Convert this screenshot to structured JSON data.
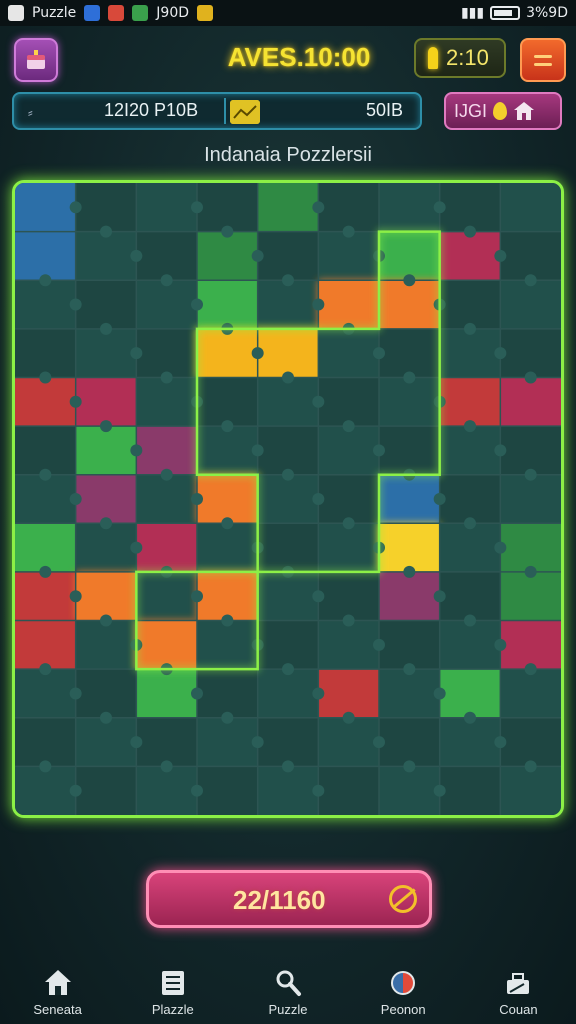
{
  "status_bar": {
    "app_name": "Puzzle",
    "game_time": "J90D",
    "right_text": "3%9D"
  },
  "hud": {
    "timer_text": "AVES.10:00",
    "hint_count": "2:10"
  },
  "stats": {
    "moves_text": "12I20 P10B",
    "score_text": "50IB",
    "powerup_label": "IJGI"
  },
  "puzzle_title": "Indanaia Pozzlersii",
  "progress_text": "22/1160",
  "colors": {
    "accent_green": "#8cf046",
    "timer_yellow": "#f5e332",
    "progress_pink": "#d8437a"
  },
  "nav": [
    {
      "label": "Seneata",
      "icon": "home-icon"
    },
    {
      "label": "Plazzle",
      "icon": "list-icon"
    },
    {
      "label": "Puzzle",
      "icon": "magnifier-icon"
    },
    {
      "label": "Peonon",
      "icon": "globe-icon"
    },
    {
      "label": "Couan",
      "icon": "toolbox-icon"
    }
  ]
}
